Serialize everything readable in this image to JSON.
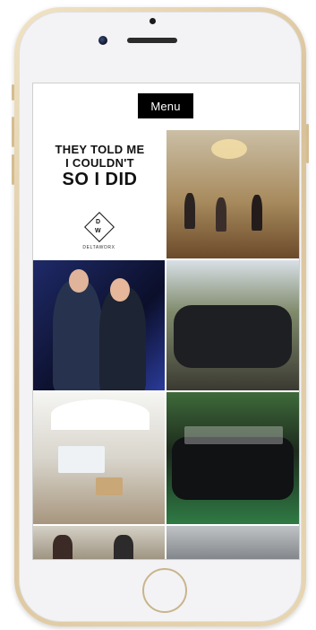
{
  "header": {
    "menu_label": "Menu"
  },
  "poster": {
    "line1": "THEY TOLD ME",
    "line2": "I COULDN'T",
    "line3": "SO I DID",
    "logo_letters": {
      "top": "D",
      "bottom": "W"
    },
    "brand": "DELTAWORX"
  },
  "gallery": {
    "photos": [
      "event-hall-photo",
      "couple-portrait-photo",
      "group-outdoor-photo",
      "tent-stand-photo",
      "sports-team-photo",
      "presentation-photo",
      "building-interior-photo"
    ]
  },
  "colors": {
    "phone_frame": "#d9c29a",
    "menu_bg": "#000000",
    "menu_text": "#ffffff"
  }
}
